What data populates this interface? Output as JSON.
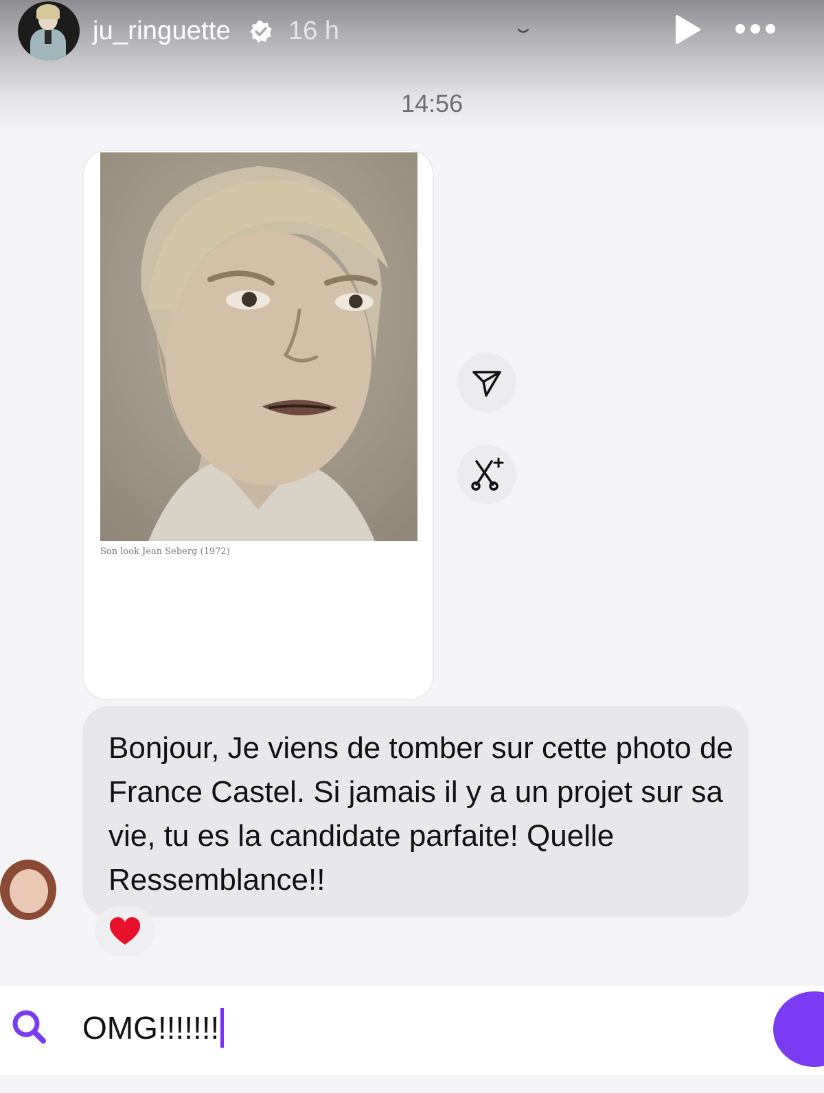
{
  "story_header": {
    "username": "ju_ringuette",
    "time_ago": "16 h",
    "icons": [
      "verified-badge-icon",
      "chevron-down-icon",
      "play-icon",
      "more-icon"
    ]
  },
  "conversation": {
    "timestamp": "14:56",
    "shared_post": {
      "caption": "Son look Jean Seberg (1972)",
      "actions": [
        "share-icon",
        "remix-icon"
      ]
    },
    "message": {
      "text": "Bonjour, Je viens de tomber sur cette photo de France Castel.  Si jamais il y a un projet sur sa vie, tu es la candidate parfaite!  Quelle Ressemblance!!",
      "reaction": "❤️"
    }
  },
  "composer": {
    "value": "OMG!!!!!!!",
    "icons": [
      "search-icon",
      "send-icon"
    ]
  },
  "colors": {
    "accent": "#7a3cf2",
    "bubble": "#e8e8ea",
    "background": "#f4f4f6"
  }
}
